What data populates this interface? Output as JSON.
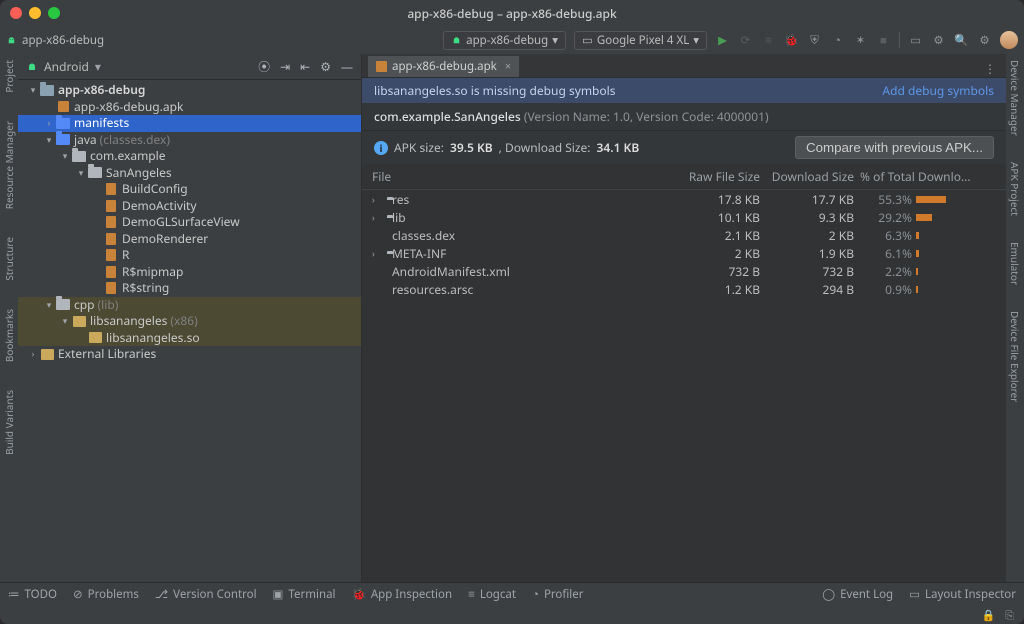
{
  "window": {
    "title": "app-x86-debug – app-x86-debug.apk"
  },
  "breadcrumb": {
    "project": "app-x86-debug"
  },
  "toolbar": {
    "run_config": "app-x86-debug",
    "device": "Google Pixel 4 XL"
  },
  "project_panel": {
    "header": "Android",
    "tree": [
      {
        "depth": 0,
        "arrow": "▾",
        "icon": "module",
        "label": "app-x86-debug",
        "bold": true
      },
      {
        "depth": 1,
        "arrow": "",
        "icon": "apk",
        "label": "app-x86-debug.apk"
      },
      {
        "depth": 1,
        "arrow": "›",
        "icon": "folder-blue",
        "label": "manifests",
        "sel": "blue"
      },
      {
        "depth": 1,
        "arrow": "▾",
        "icon": "folder-blue",
        "label": "java",
        "dim": "(classes.dex)"
      },
      {
        "depth": 2,
        "arrow": "▾",
        "icon": "folder",
        "label": "com.example"
      },
      {
        "depth": 3,
        "arrow": "▾",
        "icon": "folder",
        "label": "SanAngeles"
      },
      {
        "depth": 4,
        "arrow": "",
        "icon": "class",
        "label": "BuildConfig"
      },
      {
        "depth": 4,
        "arrow": "",
        "icon": "class",
        "label": "DemoActivity"
      },
      {
        "depth": 4,
        "arrow": "",
        "icon": "class",
        "label": "DemoGLSurfaceView"
      },
      {
        "depth": 4,
        "arrow": "",
        "icon": "class",
        "label": "DemoRenderer"
      },
      {
        "depth": 4,
        "arrow": "",
        "icon": "class",
        "label": "R"
      },
      {
        "depth": 4,
        "arrow": "",
        "icon": "class",
        "label": "R$mipmap"
      },
      {
        "depth": 4,
        "arrow": "",
        "icon": "class",
        "label": "R$string"
      },
      {
        "depth": 1,
        "arrow": "▾",
        "icon": "folder",
        "label": "cpp",
        "dim": "(lib)",
        "sel": "olive"
      },
      {
        "depth": 2,
        "arrow": "▾",
        "icon": "lib",
        "label": "libsanangeles",
        "dim": "(x86)",
        "sel": "olive"
      },
      {
        "depth": 3,
        "arrow": "",
        "icon": "lib",
        "label": "libsanangeles.so",
        "sel": "olive"
      },
      {
        "depth": 0,
        "arrow": "›",
        "icon": "lib",
        "label": "External Libraries"
      }
    ]
  },
  "editor": {
    "tab": "app-x86-debug.apk",
    "banner": {
      "text": "libsanangeles.so is missing debug symbols",
      "action": "Add debug symbols"
    },
    "packageLine": {
      "pkg": "com.example.SanAngeles",
      "meta": "(Version Name: 1.0, Version Code: 4000001)",
      "verNum": "1.0"
    },
    "sizeLine": {
      "prefix": "APK size: ",
      "apk": "39.5 KB",
      "mid": ", Download Size: ",
      "dl": "34.1 KB"
    },
    "compare": "Compare with previous APK...",
    "cols": {
      "file": "File",
      "raw": "Raw File Size",
      "dl": "Download Size",
      "pct": "% of Total Downlo..."
    },
    "rows": [
      {
        "arrow": "›",
        "icon": "folder",
        "name": "res",
        "raw": "17.8 KB",
        "dl": "17.7 KB",
        "pct": "55.3%",
        "bar": 55
      },
      {
        "arrow": "›",
        "icon": "folder",
        "name": "lib",
        "raw": "10.1 KB",
        "dl": "9.3 KB",
        "pct": "29.2%",
        "bar": 29
      },
      {
        "arrow": "",
        "icon": "dex",
        "name": "classes.dex",
        "raw": "2.1 KB",
        "dl": "2 KB",
        "pct": "6.3%",
        "bar": 6
      },
      {
        "arrow": "›",
        "icon": "folder",
        "name": "META-INF",
        "raw": "2 KB",
        "dl": "1.9 KB",
        "pct": "6.1%",
        "bar": 6
      },
      {
        "arrow": "",
        "icon": "xml",
        "name": "AndroidManifest.xml",
        "raw": "732 B",
        "dl": "732 B",
        "pct": "2.2%",
        "bar": 2
      },
      {
        "arrow": "",
        "icon": "dex",
        "name": "resources.arsc",
        "raw": "1.2 KB",
        "dl": "294 B",
        "pct": "0.9%",
        "bar": 1
      }
    ]
  },
  "left_gutter": [
    "Project",
    "Resource Manager",
    "Structure",
    "Bookmarks",
    "Build Variants"
  ],
  "right_gutter": [
    "Device Manager",
    "APK Project",
    "Emulator",
    "Device File Explorer"
  ],
  "status": {
    "items": [
      "TODO",
      "Problems",
      "Version Control",
      "Terminal",
      "App Inspection",
      "Logcat",
      "Profiler"
    ],
    "right": [
      "Event Log",
      "Layout Inspector"
    ]
  }
}
